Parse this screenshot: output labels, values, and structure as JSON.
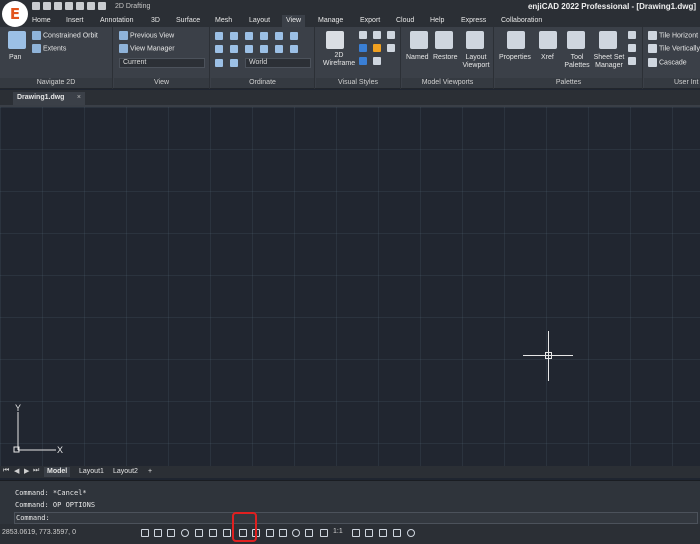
{
  "app": {
    "title": "enjiCAD 2022 Professional - [Drawing1.dwg]",
    "workspace": "2D Drafting",
    "logo_letter": "E"
  },
  "tabs": [
    "Home",
    "Insert",
    "Annotation",
    "3D",
    "Surface",
    "Mesh",
    "Layout",
    "View",
    "Manage",
    "Export",
    "Cloud",
    "Help",
    "Express",
    "Collaboration"
  ],
  "active_tab": "View",
  "ribbon": {
    "navigate": {
      "title": "Navigate 2D",
      "pan": "Pan",
      "orbit": "Constrained Orbit",
      "extents": "Extents"
    },
    "view": {
      "title": "View",
      "previous": "Previous View",
      "manager": "View Manager",
      "current": "Current"
    },
    "ordinate": {
      "title": "Ordinate",
      "world": "World"
    },
    "visual_styles": {
      "title": "Visual Styles",
      "style_label": "2D Wireframe"
    },
    "viewports": {
      "title": "Model Viewports",
      "named": "Named",
      "restore": "Restore",
      "layout_viewport": "Layout Viewport"
    },
    "palettes": {
      "title": "Palettes",
      "properties": "Properties",
      "xref": "Xref",
      "tool_palettes": "Tool Palettes",
      "sheet_set": "Sheet Set Manager"
    },
    "ui": {
      "title": "User Int",
      "tile_h": "Tile Horizont",
      "tile_v": "Tile Vertically",
      "cascade": "Cascade"
    }
  },
  "document_tab": "Drawing1.dwg",
  "ucs": {
    "y": "Y",
    "x": "X"
  },
  "layout_tabs": [
    "Model",
    "Layout1",
    "Layout2",
    "+"
  ],
  "active_layout": "Model",
  "command_history": [
    "Command: *Cancel*",
    "Command: OP OPTIONS"
  ],
  "command_prompt": "Command:",
  "status": {
    "coordinates": "2853.0619, 773.3597, 0",
    "scale": "1:1"
  },
  "colors": {
    "canvas": "#212630",
    "ribbon": "#3b4048",
    "highlight": "#e02020",
    "logo": "#e2531c"
  }
}
